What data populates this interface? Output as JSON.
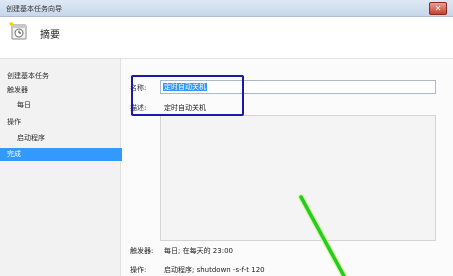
{
  "window": {
    "title": "创建基本任务向导",
    "close_glyph": "✕"
  },
  "header": {
    "heading": "摘要",
    "icon": "scheduled-task-wizard-icon"
  },
  "nav": {
    "items": [
      {
        "label": "创建基本任务",
        "active": false
      },
      {
        "label": "触发器",
        "active": false
      },
      {
        "label": "每日",
        "active": false
      },
      {
        "label": "操作",
        "active": false
      },
      {
        "label": "启动程序",
        "active": false
      },
      {
        "label": "完成",
        "active": true
      }
    ]
  },
  "form": {
    "name_label": "名称:",
    "name_value": "定时自动关机",
    "desc_label": "描述:",
    "desc_value": "定时自动关机"
  },
  "summary": {
    "trigger_label": "触发器:",
    "trigger_value": "每日; 在每天的 23:00",
    "action_label": "操作:",
    "action_value": "启动程序; shutdown -s-f-t 120"
  },
  "colors": {
    "selection": "#3399ff",
    "highlight_box": "#1a1aa6",
    "arrow": "#22cc22"
  }
}
